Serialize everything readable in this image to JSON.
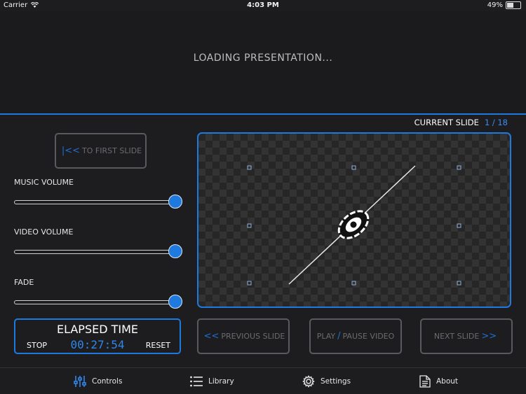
{
  "status_bar": {
    "carrier": "Carrier",
    "time": "4:03 PM",
    "battery": "49%",
    "battery_level": 0.49
  },
  "header": {
    "loading_text": "LOADING PRESENTATION..."
  },
  "current_slide": {
    "label": "CURRENT SLIDE",
    "value": "1 / 18"
  },
  "buttons": {
    "first_slide_prefix": "|<<",
    "first_slide": "TO FIRST SLIDE",
    "previous_prefix": "<<",
    "previous": "PREVIOUS SLIDE",
    "play": "PLAY",
    "play_sep": "/",
    "pause": "PAUSE VIDEO",
    "next": "NEXT SLIDE",
    "next_suffix": ">>"
  },
  "sliders": {
    "music": {
      "label": "MUSIC VOLUME",
      "value": 1.0
    },
    "video": {
      "label": "VIDEO VOLUME",
      "value": 1.0
    },
    "fade": {
      "label": "FADE",
      "value": 1.0
    }
  },
  "timer": {
    "title": "ELAPSED TIME",
    "stop": "STOP",
    "time": "00:27:54",
    "reset": "RESET"
  },
  "tabs": [
    {
      "label": "Controls",
      "icon": "sliders-icon",
      "active": true
    },
    {
      "label": "Library",
      "icon": "list-icon"
    },
    {
      "label": "Settings",
      "icon": "gear-icon"
    },
    {
      "label": "About",
      "icon": "document-icon"
    }
  ],
  "colors": {
    "accent": "#1f7ae0",
    "background": "#1d1d1f"
  }
}
